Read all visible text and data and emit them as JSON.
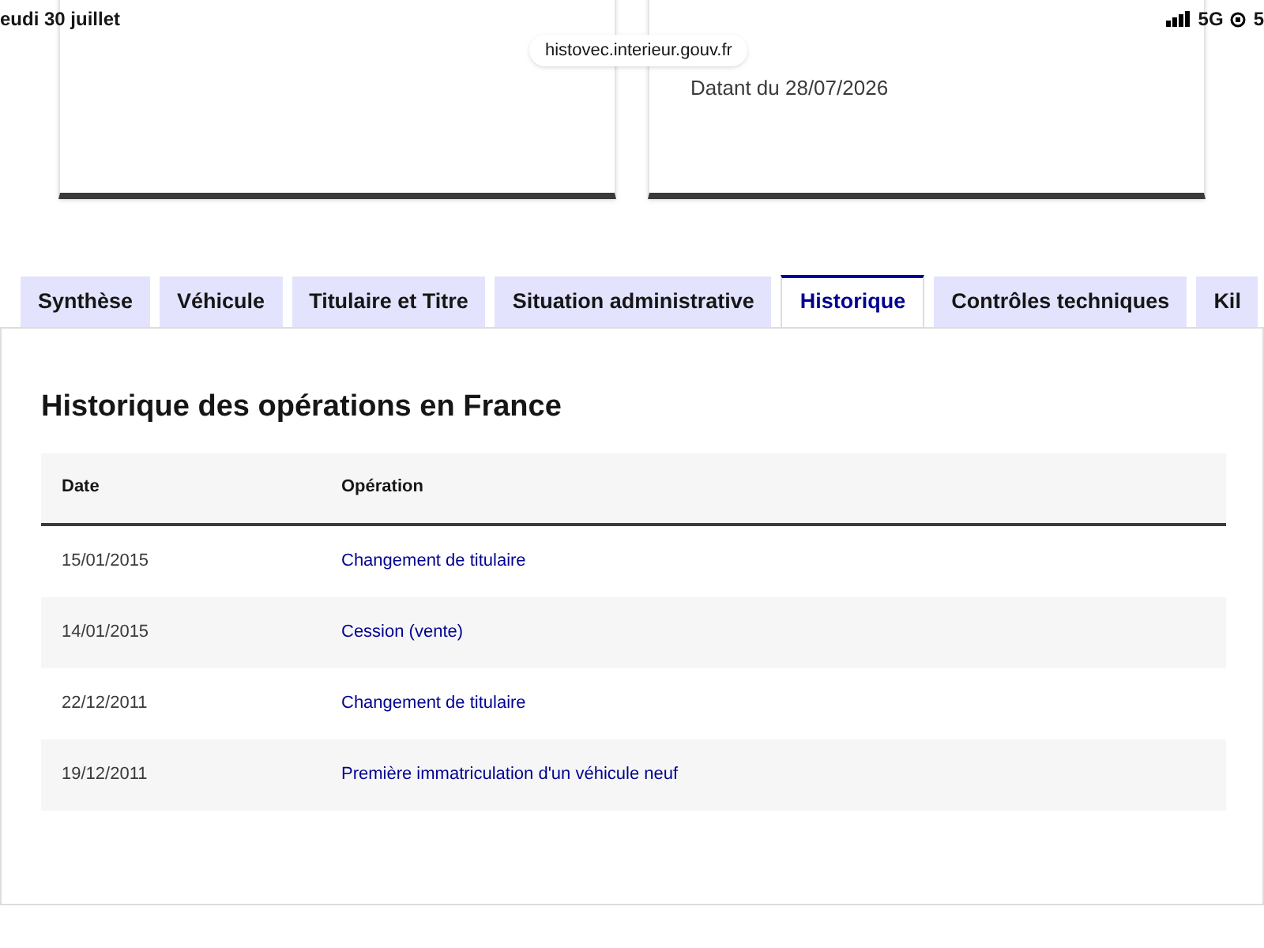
{
  "status_bar": {
    "date": "eudi 30 juillet",
    "network": "5G",
    "battery": "5"
  },
  "address_bar": {
    "url": "histovec.interieur.gouv.fr"
  },
  "cards": [
    {
      "kind": "blank"
    },
    {
      "kind": "dated",
      "date": "Datant du 28/07/2026"
    }
  ],
  "tabs": [
    {
      "label": "Synthèse",
      "selected": false
    },
    {
      "label": "Véhicule",
      "selected": false
    },
    {
      "label": "Titulaire et Titre",
      "selected": false
    },
    {
      "label": "Situation administrative",
      "selected": false
    },
    {
      "label": "Historique",
      "selected": true
    },
    {
      "label": "Contrôles techniques",
      "selected": false
    },
    {
      "label": "Kil",
      "selected": false
    }
  ],
  "section": {
    "title": "Historique des opérations en France"
  },
  "table": {
    "columns": [
      "Date",
      "Opération"
    ],
    "rows": [
      {
        "date": "15/01/2015",
        "operation": "Changement de titulaire"
      },
      {
        "date": "14/01/2015",
        "operation": "Cession (vente)"
      },
      {
        "date": "22/12/2011",
        "operation": "Changement de titulaire"
      },
      {
        "date": "19/12/2011",
        "operation": "Première immatriculation d'un véhicule neuf"
      }
    ]
  }
}
